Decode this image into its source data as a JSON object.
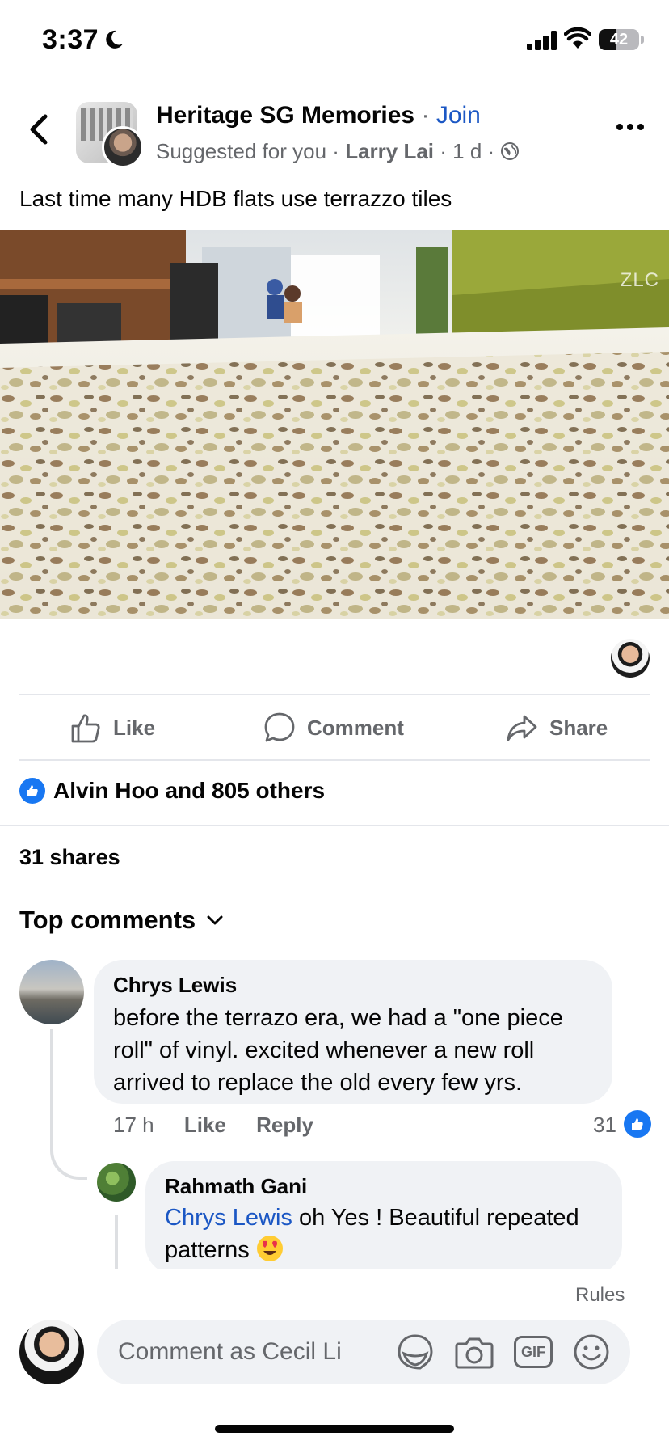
{
  "status_bar": {
    "time": "3:37",
    "battery_level": "42",
    "battery_fraction": 0.42,
    "icons": [
      "moon-icon",
      "signal-icon",
      "wifi-icon",
      "battery-icon"
    ]
  },
  "header": {
    "group_name": "Heritage SG Memories",
    "separator": "·",
    "join_label": "Join",
    "suggested": "Suggested for you",
    "author": "Larry Lai",
    "time_ago": "1 d",
    "icons": [
      "back-icon",
      "globe-icon",
      "more-icon"
    ]
  },
  "post": {
    "text": "Last time many HDB flats use terrazzo tiles",
    "photo_watermark": "ZLC"
  },
  "actions": {
    "like_label": "Like",
    "comment_label": "Comment",
    "share_label": "Share"
  },
  "reactions": {
    "text": "Alvin Hoo and 805 others"
  },
  "shares_text": "31 shares",
  "comments_header": "Top comments",
  "comments": [
    {
      "author": "Chrys Lewis",
      "text": "before the terrazo era, we had a \"one piece roll\" of vinyl. excited whenever a new roll arrived to replace the old every few yrs.",
      "time": "17 h",
      "like_label": "Like",
      "reply_label": "Reply",
      "like_count": "31"
    },
    {
      "author": "Rahmath Gani",
      "mention": "Chrys Lewis",
      "text": "oh Yes ! Beautiful repeated",
      "text_line2": "patterns"
    }
  ],
  "composer": {
    "rules_label": "Rules",
    "placeholder": "Comment as Cecil Li",
    "icons": [
      "sticker-icon",
      "camera-icon",
      "gif-icon",
      "emoji-icon"
    ],
    "gif_label": "GIF"
  },
  "colors": {
    "accent": "#1877f2",
    "link": "#1b57c4",
    "secondary_text": "#65676b",
    "bubble": "#f0f2f5"
  }
}
